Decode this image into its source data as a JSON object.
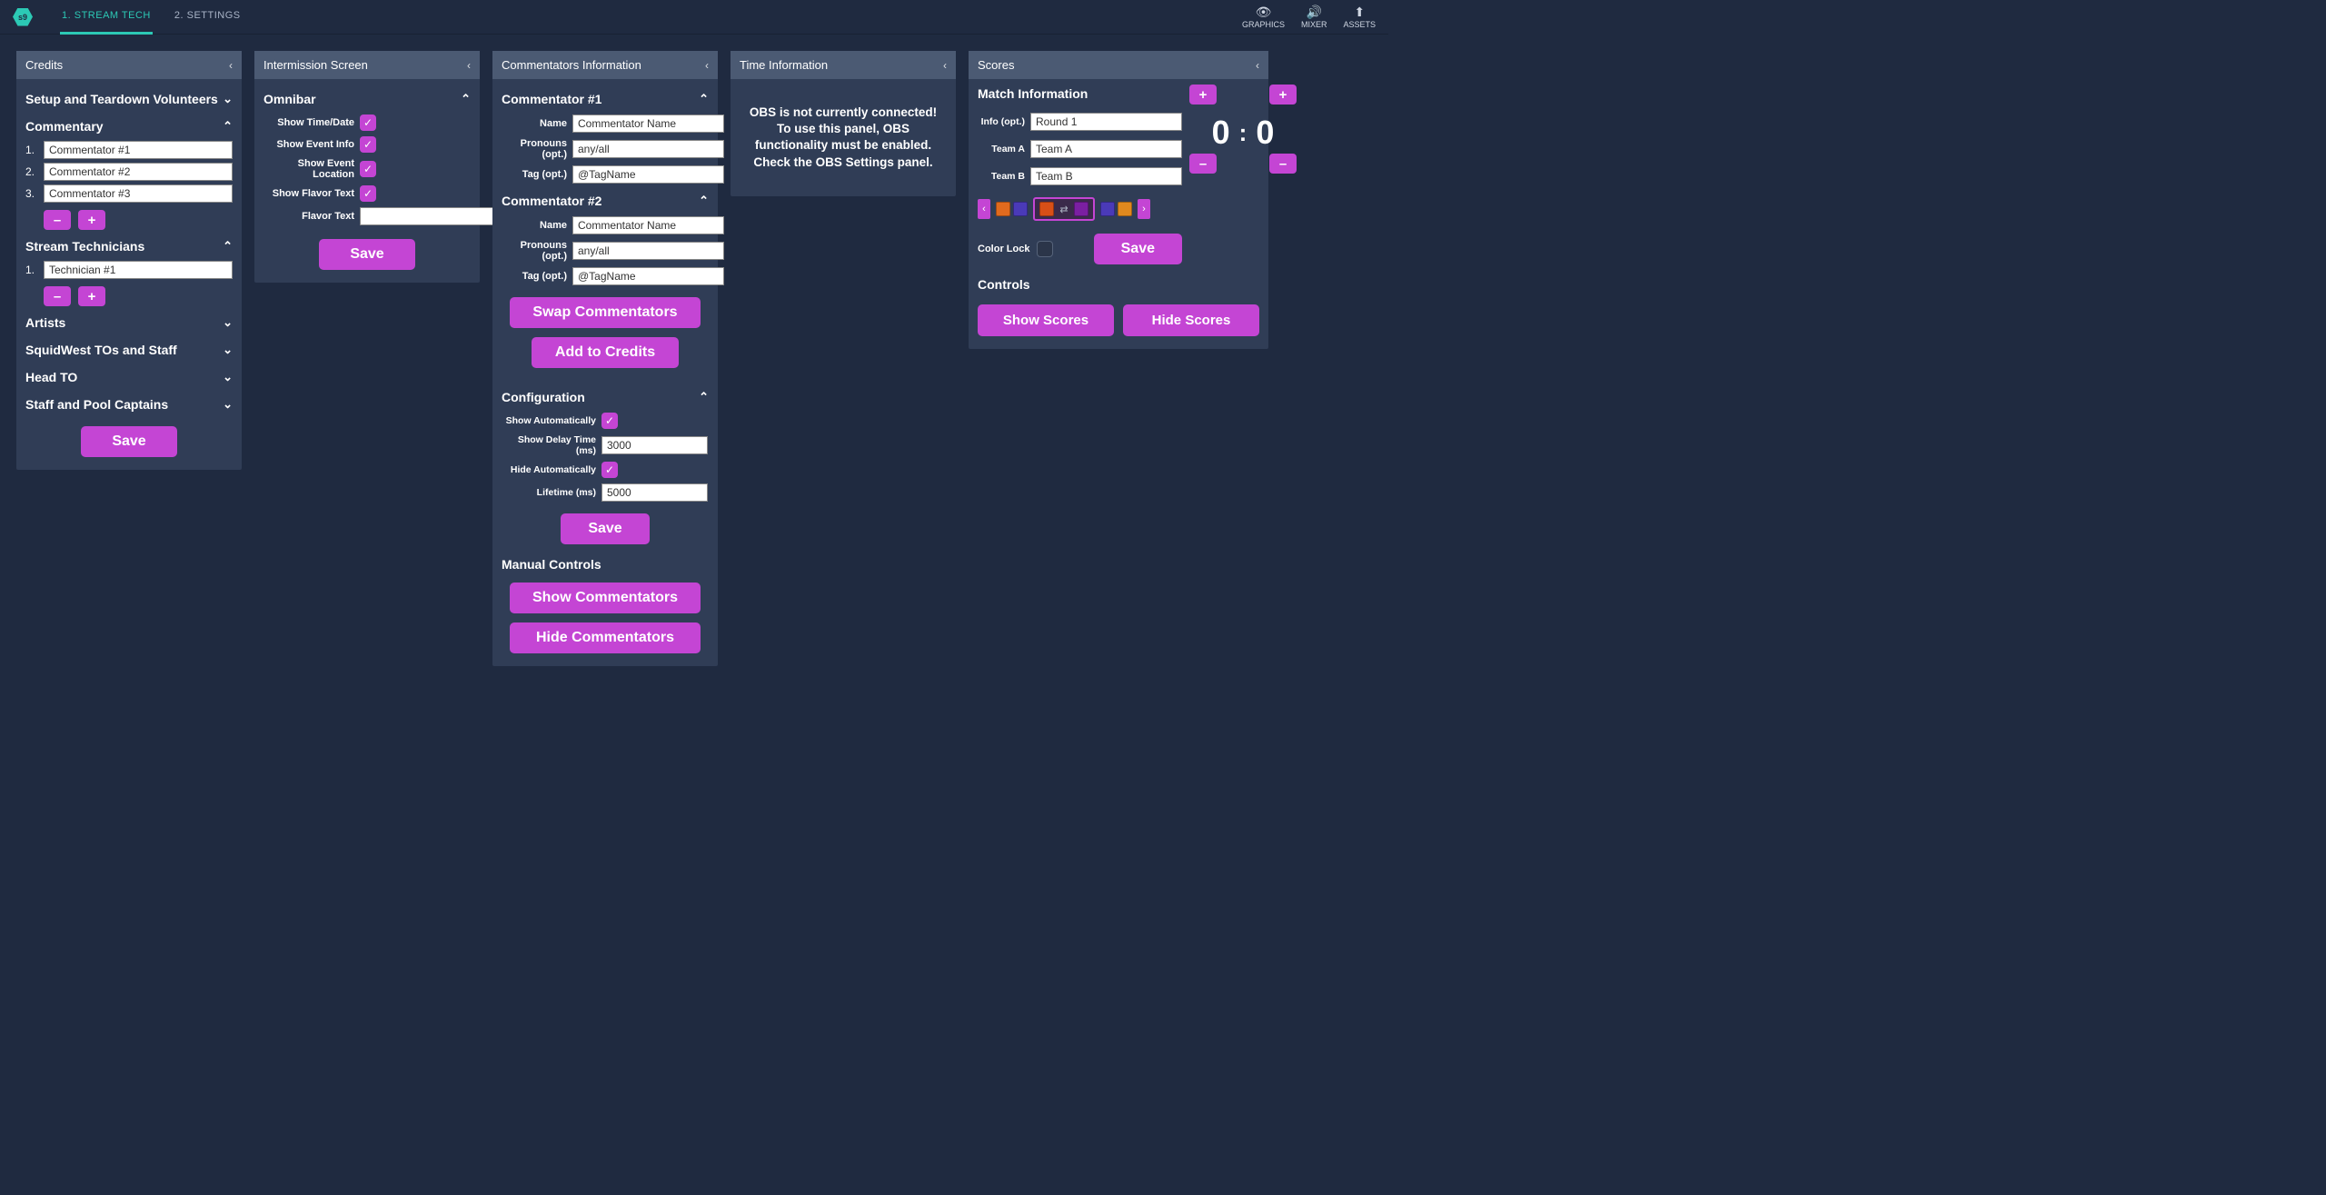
{
  "tabs": {
    "t1": "1. STREAM TECH",
    "t2": "2. SETTINGS"
  },
  "topicons": {
    "graphics": "GRAPHICS",
    "mixer": "MIXER",
    "assets": "ASSETS"
  },
  "credits": {
    "title": "Credits",
    "setup": "Setup and Teardown Volunteers",
    "commentary": "Commentary",
    "commentators": [
      "Commentator #1",
      "Commentator #2",
      "Commentator #3"
    ],
    "streamtech_title": "Stream Technicians",
    "technicians": [
      "Technician #1"
    ],
    "artists": "Artists",
    "tos": "SquidWest TOs and Staff",
    "headto": "Head TO",
    "staff": "Staff and Pool Captains",
    "save": "Save",
    "minus": "–",
    "plus": "+"
  },
  "intermission": {
    "title": "Intermission Screen",
    "omnibar": "Omnibar",
    "show_timedate": "Show Time/Date",
    "show_event_info": "Show Event Info",
    "show_event_location": "Show Event Location",
    "show_flavor": "Show Flavor Text",
    "flavor_label": "Flavor Text",
    "flavor_value": "",
    "save": "Save"
  },
  "commentators": {
    "title": "Commentators Information",
    "c1_title": "Commentator #1",
    "c2_title": "Commentator #2",
    "name_label": "Name",
    "pronouns_label": "Pronouns (opt.)",
    "tag_label": "Tag (opt.)",
    "c1_name": "Commentator Name",
    "c1_pronouns": "any/all",
    "c1_tag": "@TagName",
    "c2_name": "Commentator Name",
    "c2_pronouns": "any/all",
    "c2_tag": "@TagName",
    "swap": "Swap Commentators",
    "addcredits": "Add to Credits",
    "config_title": "Configuration",
    "show_auto": "Show Automatically",
    "show_delay_label": "Show Delay Time (ms)",
    "show_delay": "3000",
    "hide_auto": "Hide Automatically",
    "lifetime_label": "Lifetime (ms)",
    "lifetime": "5000",
    "save": "Save",
    "manual_title": "Manual Controls",
    "show_comm": "Show Commentators",
    "hide_comm": "Hide Commentators"
  },
  "timeinfo": {
    "title": "Time Information",
    "msg": "OBS is not currently connected! To use this panel, OBS functionality must be enabled. Check the OBS Settings panel."
  },
  "scores": {
    "title": "Scores",
    "match_info": "Match Information",
    "info_label": "Info (opt.)",
    "info": "Round 1",
    "teama_label": "Team A",
    "teama": "Team A",
    "teamb_label": "Team B",
    "teamb": "Team B",
    "score_a": "0",
    "score_b": "0",
    "colon": ":",
    "color_lock": "Color Lock",
    "save": "Save",
    "controls": "Controls",
    "show": "Show Scores",
    "hide": "Hide Scores",
    "plus": "+",
    "minus": "–",
    "swatches": {
      "pair1": [
        "#e06a1e",
        "#4a3ab8"
      ],
      "selected": [
        "#d84f17",
        "#7b1fa2"
      ],
      "pair3": [
        "#4a3ab8",
        "#e0891e"
      ]
    }
  }
}
